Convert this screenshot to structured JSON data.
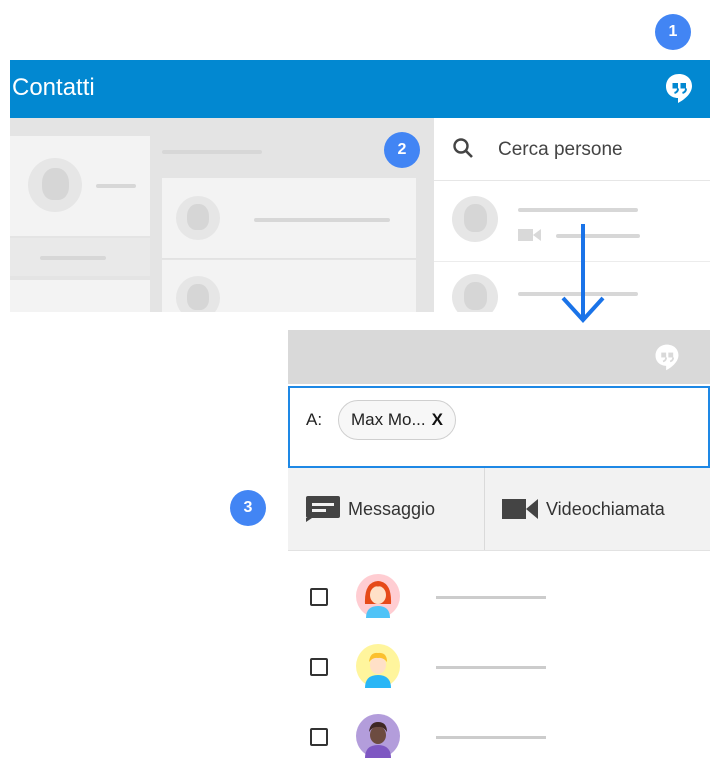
{
  "steps": [
    "1",
    "2",
    "3"
  ],
  "app_bar": {
    "title": "Contatti",
    "color": "#0288d1"
  },
  "search": {
    "placeholder": "Cerca persone"
  },
  "compose": {
    "to_label": "A:",
    "recipient_chip": {
      "name": "Max Mo...",
      "remove": "X"
    }
  },
  "actions": [
    {
      "icon": "message-icon",
      "label": "Messaggio"
    },
    {
      "icon": "videocam-icon",
      "label": "Videochiamata"
    }
  ],
  "contacts": [
    {
      "avatar": "red-hair-avatar-icon",
      "checked": false
    },
    {
      "avatar": "blond-avatar-icon",
      "checked": false
    },
    {
      "avatar": "dark-skin-avatar-icon",
      "checked": false
    }
  ],
  "colors": {
    "accent": "#4285f4",
    "focus_border": "#1e88e5"
  }
}
